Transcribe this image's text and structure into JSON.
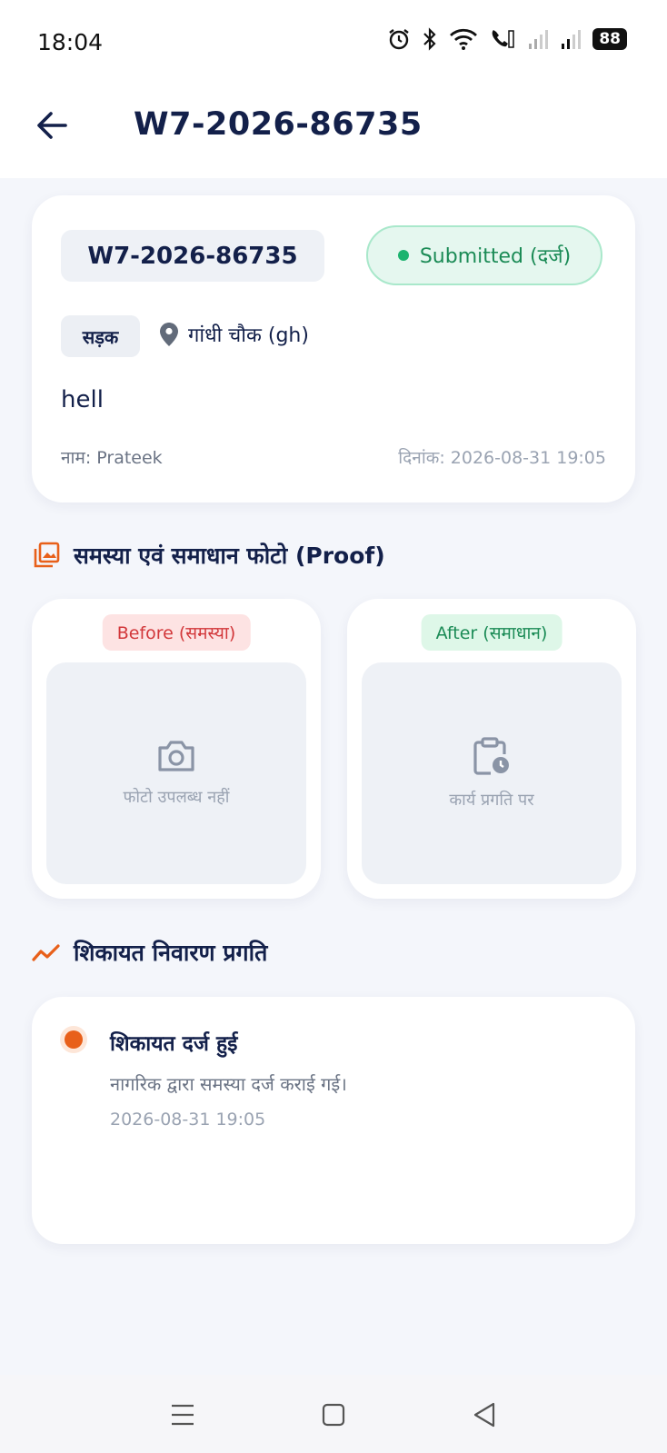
{
  "status_bar": {
    "time": "18:04",
    "battery": "88"
  },
  "header": {
    "title": "W7-2026-86735"
  },
  "complaint": {
    "id": "W7-2026-86735",
    "status": "Submitted (दर्ज)",
    "category": "सड़क",
    "location": "गांधी चौक (gh)",
    "description": "hell",
    "name_line": "नाम: Prateek",
    "date_line": "दिनांक: 2026-08-31 19:05"
  },
  "photos": {
    "section_title": "समस्या एवं समाधान फोटो (Proof)",
    "before": {
      "badge": "Before (समस्या)",
      "caption": "फोटो उपलब्ध नहीं"
    },
    "after": {
      "badge": "After (समाधान)",
      "caption": "कार्य प्रगति पर"
    }
  },
  "progress": {
    "section_title": "शिकायत निवारण प्रगति",
    "items": [
      {
        "title": "शिकायत दर्ज हुई",
        "description": "नागरिक द्वारा समस्या दर्ज कराई गई।",
        "time": "2026-08-31 19:05"
      }
    ]
  },
  "colors": {
    "primary": "#13204a",
    "success": "#1b8b56",
    "danger": "#d2373a",
    "accent": "#e8601a"
  },
  "icons": {
    "back": "arrow-left-icon",
    "location": "map-pin-icon",
    "photo_section": "image-gallery-icon",
    "camera": "camera-icon",
    "work_progress": "clipboard-clock-icon",
    "progress_section": "trend-line-icon"
  }
}
